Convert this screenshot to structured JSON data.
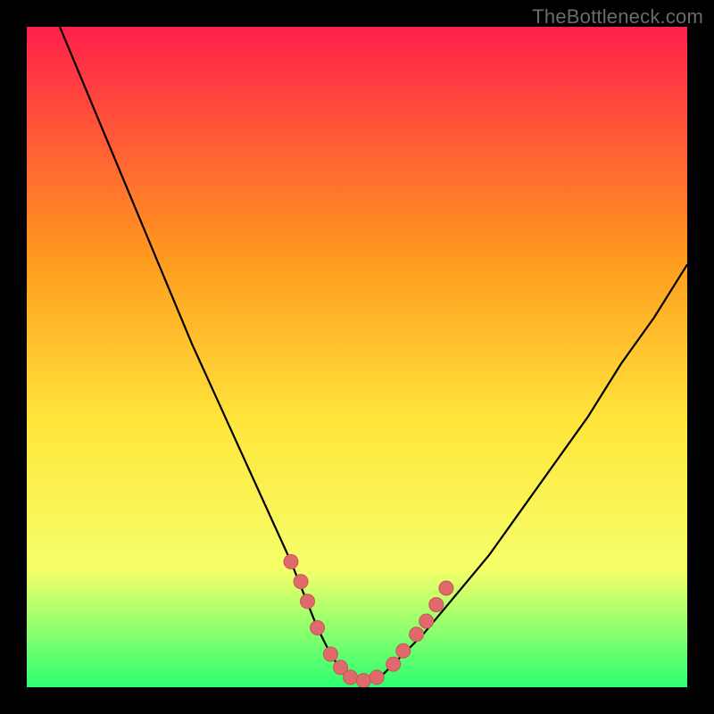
{
  "watermark": "TheBottleneck.com",
  "colors": {
    "bg": "#000000",
    "gradient_top": "#ff1f4b",
    "gradient_mid1": "#ff9a1f",
    "gradient_mid2": "#ffe63b",
    "gradient_mid3": "#f6ff6a",
    "gradient_bottom": "#2cff70",
    "curve": "#000000",
    "marker_fill": "#de6a6c",
    "marker_stroke": "#c95557"
  },
  "chart_data": {
    "type": "line",
    "title": "",
    "xlabel": "",
    "ylabel": "",
    "xlim": [
      0,
      100
    ],
    "ylim": [
      0,
      100
    ],
    "series": [
      {
        "name": "bottleneck-curve",
        "x": [
          5,
          10,
          15,
          20,
          25,
          30,
          35,
          40,
          42,
          44,
          46,
          48,
          50,
          52,
          54,
          56,
          60,
          65,
          70,
          75,
          80,
          85,
          90,
          95,
          100
        ],
        "y": [
          100,
          88,
          76,
          64,
          52,
          41,
          30,
          19,
          14,
          9,
          5,
          2,
          1,
          1,
          2,
          4,
          8,
          14,
          20,
          27,
          34,
          41,
          49,
          56,
          64
        ]
      }
    ],
    "markers": {
      "name": "highlighted-points",
      "x": [
        40,
        41.5,
        42.5,
        44,
        46,
        47.5,
        49,
        51,
        53,
        55.5,
        57,
        59,
        60.5,
        62,
        63.5
      ],
      "y": [
        19,
        16,
        13,
        9,
        5,
        3,
        1.5,
        1,
        1.5,
        3.5,
        5.5,
        8,
        10,
        12.5,
        15
      ]
    }
  }
}
